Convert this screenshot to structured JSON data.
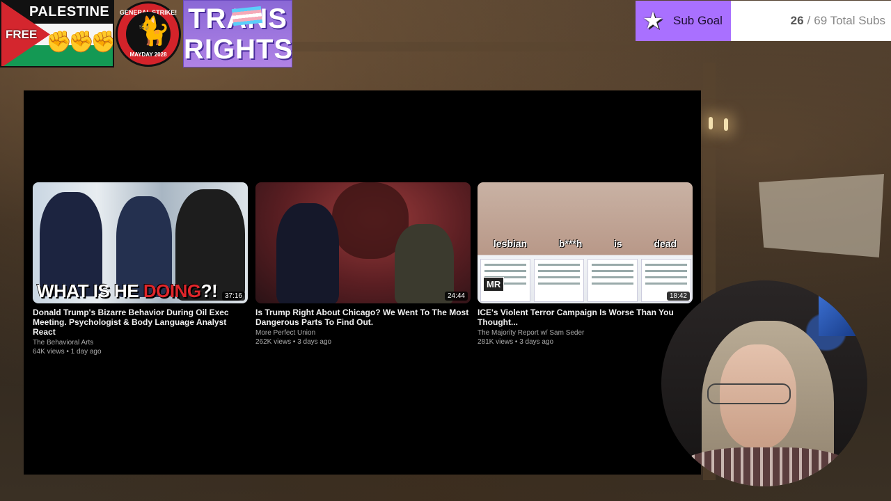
{
  "badges": {
    "palestine": {
      "title": "PALESTINE",
      "free": "FREE"
    },
    "strike": {
      "top": "GENERAL STRIKE!",
      "bottom": "MAYDAY 2028"
    },
    "trans": {
      "line1": "TRANS",
      "line2": "RIGHTS"
    }
  },
  "sub_goal": {
    "label": "Sub Goal",
    "current": "26",
    "separator": "/",
    "total_text": "69 Total Subs"
  },
  "videos": [
    {
      "thumb_headline_a": "WHAT IS HE ",
      "thumb_headline_b": "DOING",
      "thumb_headline_c": "?!",
      "duration": "37:16",
      "title": "Donald Trump's Bizarre Behavior During Oil Exec Meeting. Psychologist & Body Language Analyst React",
      "channel": "The Behavioral Arts",
      "meta": "64K views • 1 day ago"
    },
    {
      "duration": "24:44",
      "title": "Is Trump Right About Chicago? We Went To The Most Dangerous Parts To Find Out.",
      "channel": "More Perfect Union",
      "meta": "262K views • 3 days ago"
    },
    {
      "thumb_words": [
        "lesbian",
        "b***h",
        "is",
        "dead"
      ],
      "thumb_logo": "MR",
      "duration": "18:42",
      "title": "ICE's Violent Terror Campaign Is Worse Than You Thought...",
      "channel": "The Majority Report w/ Sam Seder",
      "meta": "281K views • 3 days ago"
    }
  ]
}
